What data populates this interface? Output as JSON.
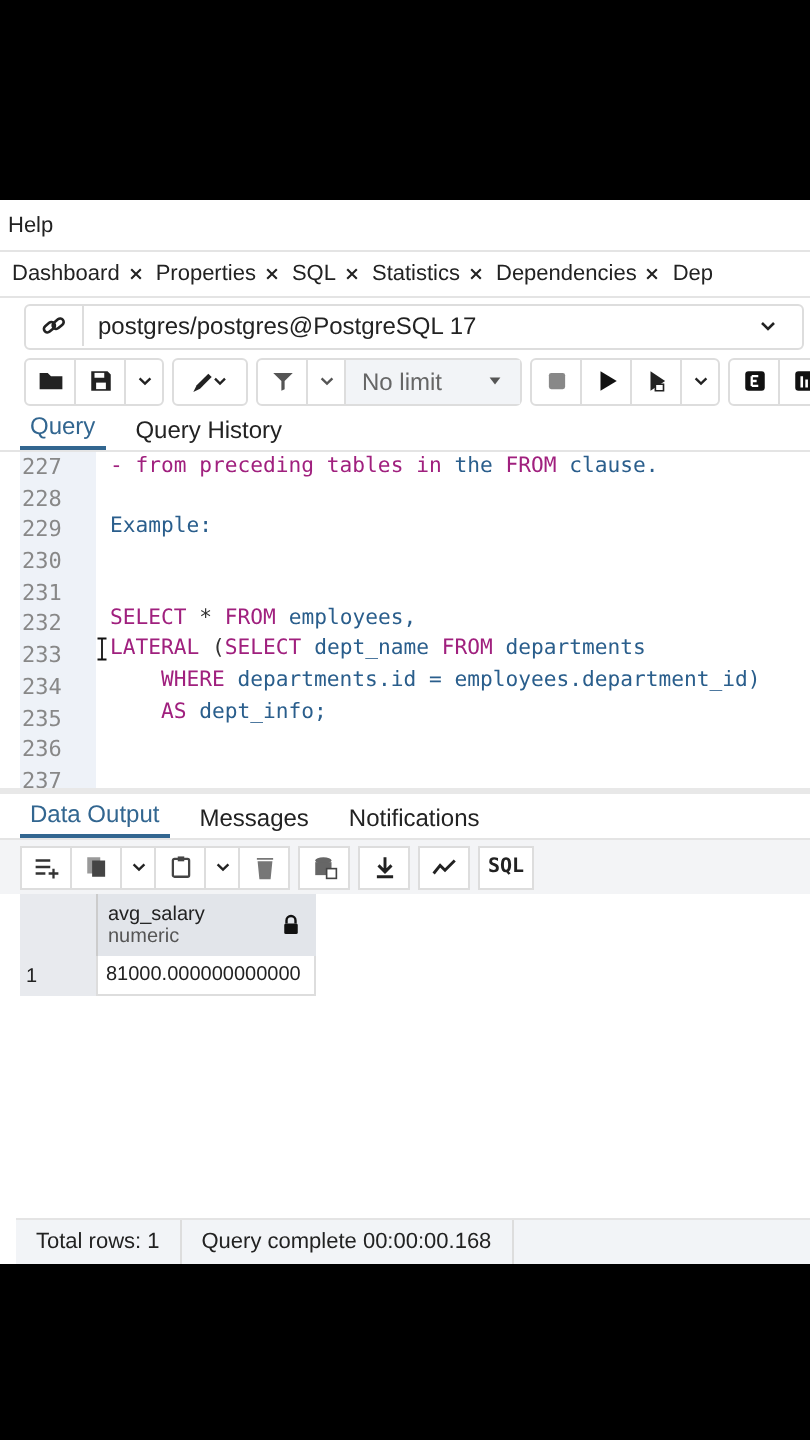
{
  "menu": [
    "Help"
  ],
  "tabs": [
    {
      "label": "Dashboard",
      "selected": false
    },
    {
      "label": "Properties",
      "selected": false
    },
    {
      "label": "SQL",
      "selected": false
    },
    {
      "label": "Statistics",
      "selected": false
    },
    {
      "label": "Dependencies",
      "selected": false
    },
    {
      "label": "Dep",
      "selected": false
    }
  ],
  "connection": {
    "label": "postgres/postgres@PostgreSQL 17"
  },
  "toolbar": {
    "row_limit": "No limit"
  },
  "query_tabs": [
    {
      "label": "Query",
      "selected": true
    },
    {
      "label": "Query History",
      "selected": false
    }
  ],
  "editor": {
    "lines": [
      {
        "number": "227",
        "tokens": [
          {
            "text": "- from preceding tables in ",
            "kind": "keyword"
          },
          {
            "text": "the ",
            "kind": "name"
          },
          {
            "text": "FROM ",
            "kind": "keyword"
          },
          {
            "text": "clause.",
            "kind": "name"
          }
        ]
      },
      {
        "number": "228"
      },
      {
        "number": "229",
        "tokens": [
          {
            "text": "Example:",
            "kind": "name"
          }
        ]
      },
      {
        "number": "230"
      },
      {
        "number": "231"
      },
      {
        "number": "232",
        "tokens": [
          {
            "text": "SELECT ",
            "kind": "keyword"
          },
          {
            "text": "* ",
            "kind": "plain"
          },
          {
            "text": "FROM ",
            "kind": "keyword"
          },
          {
            "text": "employees, ",
            "kind": "name"
          }
        ]
      },
      {
        "number": "233",
        "tokens": [
          {
            "text": "LATERAL ",
            "kind": "keyword"
          },
          {
            "text": "(",
            "kind": "plain"
          },
          {
            "text": "SELECT ",
            "kind": "keyword"
          },
          {
            "text": "dept_name ",
            "kind": "name"
          },
          {
            "text": "FROM ",
            "kind": "keyword"
          },
          {
            "text": "departments",
            "kind": "name"
          }
        ]
      },
      {
        "number": "234",
        "tokens": [
          {
            "text": "    WHERE ",
            "kind": "keyword"
          },
          {
            "text": "departments.id = employees.department_id)",
            "kind": "name"
          }
        ]
      },
      {
        "number": "235",
        "tokens": [
          {
            "text": "    AS ",
            "kind": "keyword"
          },
          {
            "text": "dept_info;",
            "kind": "name"
          }
        ]
      },
      {
        "number": "236"
      },
      {
        "number": "237"
      }
    ]
  },
  "output_tabs": [
    {
      "label": "Data Output",
      "selected": true
    },
    {
      "label": "Messages",
      "selected": false
    },
    {
      "label": "Notifications",
      "selected": false
    }
  ],
  "output_toolbar": {
    "sql_button": "SQL"
  },
  "grid": {
    "columns": [
      {
        "name": "avg_salary",
        "type": "numeric",
        "locked": true
      }
    ],
    "rows": [
      {
        "number": "1",
        "cells": [
          "81000.000000000000"
        ]
      }
    ]
  },
  "status_bar": [
    "Total rows: 1",
    "Query complete 00:00:00.168"
  ]
}
